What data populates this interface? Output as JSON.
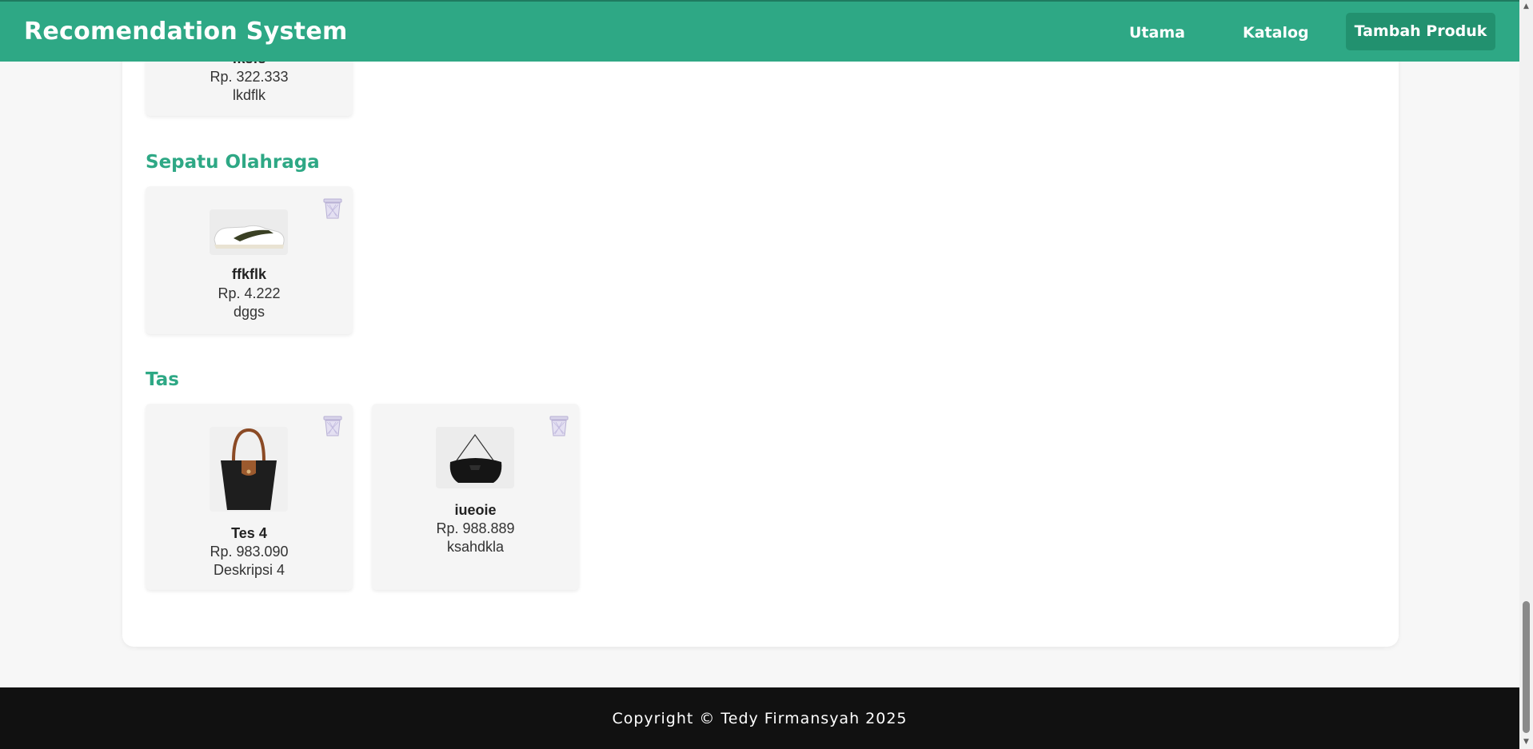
{
  "navbar": {
    "brand": "Recomendation System",
    "links": {
      "utama": "Utama",
      "katalog": "Katalog",
      "tambah": "Tambah Produk"
    },
    "color": "#2ea885"
  },
  "sections": {
    "prev": {
      "card": {
        "name": "fksfs",
        "price": "Rp. 322.333",
        "desc": "lkdflk"
      }
    },
    "sepatu": {
      "title": "Sepatu Olahraga",
      "card": {
        "name": "ffkflk",
        "price": "Rp. 4.222",
        "desc": "dggs",
        "image": "white-sneaker"
      }
    },
    "tas": {
      "title": "Tas",
      "cards": [
        {
          "name": "Tes 4",
          "price": "Rp. 983.090",
          "desc": "Deskripsi 4",
          "image": "black-tote-bag"
        },
        {
          "name": "iueoie",
          "price": "Rp. 988.889",
          "desc": "ksahdkla",
          "image": "black-shoulder-bag"
        }
      ]
    }
  },
  "footer": {
    "text": "Copyright © Tedy Firmansyah 2025"
  },
  "icons": {
    "delete": "trash-icon"
  }
}
